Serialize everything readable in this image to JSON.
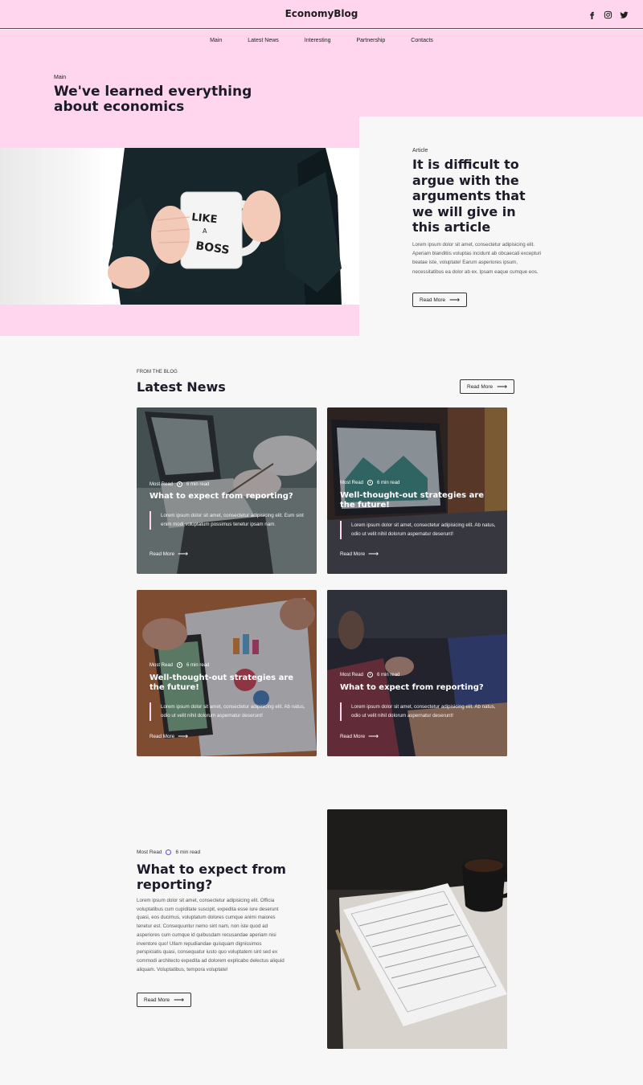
{
  "header": {
    "logo": "EconomyBlog",
    "social": [
      "facebook-icon",
      "instagram-icon",
      "twitter-icon"
    ]
  },
  "nav": {
    "items": [
      "Main",
      "Latest News",
      "Interesting",
      "Partnership",
      "Contacts"
    ]
  },
  "hero": {
    "kicker": "Main",
    "title": "We've learned everything about economics",
    "image_text": "LIKE A BOSS"
  },
  "article": {
    "kicker": "Article",
    "title": "It is difficult to argue with the arguments that we will give in this article",
    "text": "Lorem ipsum dolor sit amet, consectetur adipisicing elit. Aperiam blanditiis voluptas incidunt ab obcaecati excepturi beatae iste, voluptate! Earum asperiores ipsum, necessitatibus ea dolor ab ex. Ipsam eaque cumque eos.",
    "button": "Read More"
  },
  "latest": {
    "kicker": "From the blog",
    "title": "Latest News",
    "button": "Read More",
    "cards": [
      {
        "label": "Most Read",
        "time": "6 min read",
        "title": "What to expect from reporting?",
        "excerpt": "Lorem ipsum dolor sit amet, consectetur adipisicing elit. Eum sint enim modi voluptatum possimus tenetur ipsam nam.",
        "more": "Read More"
      },
      {
        "label": "Most Read",
        "time": "6 min read",
        "title": "Well-thought-out strategies are the future!",
        "excerpt": "Lorem ipsum dolor sit amet, consectetur adipisicing elit. Ab natus, odio ut velit nihil dolorum aspernatur deserunt!",
        "more": "Read More"
      },
      {
        "label": "Most Read",
        "time": "6 min read",
        "title": "Well-thought-out strategies are the future!",
        "excerpt": "Lorem ipsum dolor sit amet, consectetur adipisicing elit. Ab natus, odio ut velit nihil dolorum aspernatur deserunt!",
        "more": "Read More"
      },
      {
        "label": "Most Read",
        "time": "6 min read",
        "title": "What to expect from reporting?",
        "excerpt": "Lorem ipsum dolor sit amet, consectetur adipisicing elit. Ab natus, odio ut velit nihil dolorum aspernatur deserunt!",
        "more": "Read More"
      }
    ]
  },
  "featured": {
    "label": "Most Read",
    "time": "6 min read",
    "title": "What to expect from reporting?",
    "text": "Lorem ipsum dolor sit amet, consectetur adipisicing elit. Officia voluptatibus cum cupiditate suscipit, expedita esse iure deserunt quasi, eos ducimus, voluptatum dolores cumque animi maiores tenetur est. Consequuntur nemo sint nam, non iste quod ad asperiores cum cumque id quibusdam recusandae aperiam nisi inventore quo! Ullam repudiandae quisquam dignissimos perspiciatis quasi, consequatur iusto quo voluptatem sint sed ex commodi architecto expedita ad dolorem explicabo delectus aliquid aliquam. Voluptatibus, tempora voluptate!",
    "button": "Read More"
  },
  "colors": {
    "pink": "#ffd6ee",
    "dark": "#1b1b2a",
    "page": "#f7f7f7"
  }
}
